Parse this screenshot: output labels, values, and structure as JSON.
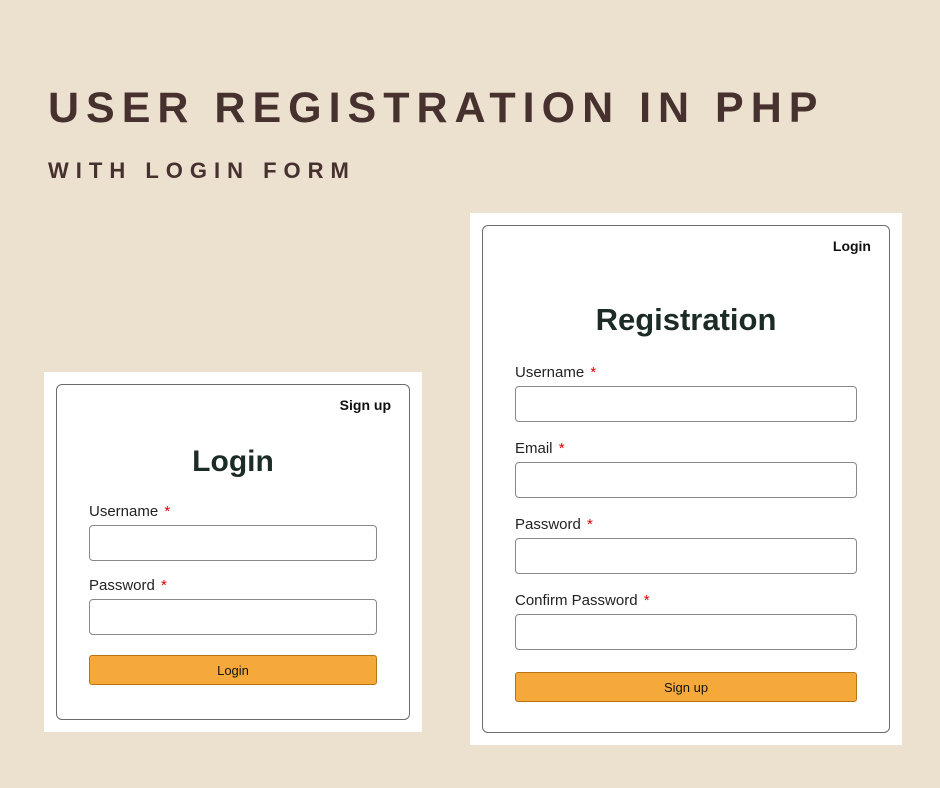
{
  "heading": {
    "title": "USER REGISTRATION IN PHP",
    "subtitle": "WITH LOGIN FORM"
  },
  "loginForm": {
    "topLink": "Sign up",
    "title": "Login",
    "fields": {
      "username": {
        "label": "Username",
        "required": "*",
        "value": ""
      },
      "password": {
        "label": "Password",
        "required": "*",
        "value": ""
      }
    },
    "submit": "Login"
  },
  "registerForm": {
    "topLink": "Login",
    "title": "Registration",
    "fields": {
      "username": {
        "label": "Username",
        "required": "*",
        "value": ""
      },
      "email": {
        "label": "Email",
        "required": "*",
        "value": ""
      },
      "password": {
        "label": "Password",
        "required": "*",
        "value": ""
      },
      "confirm": {
        "label": "Confirm Password",
        "required": "*",
        "value": ""
      }
    },
    "submit": "Sign up"
  }
}
